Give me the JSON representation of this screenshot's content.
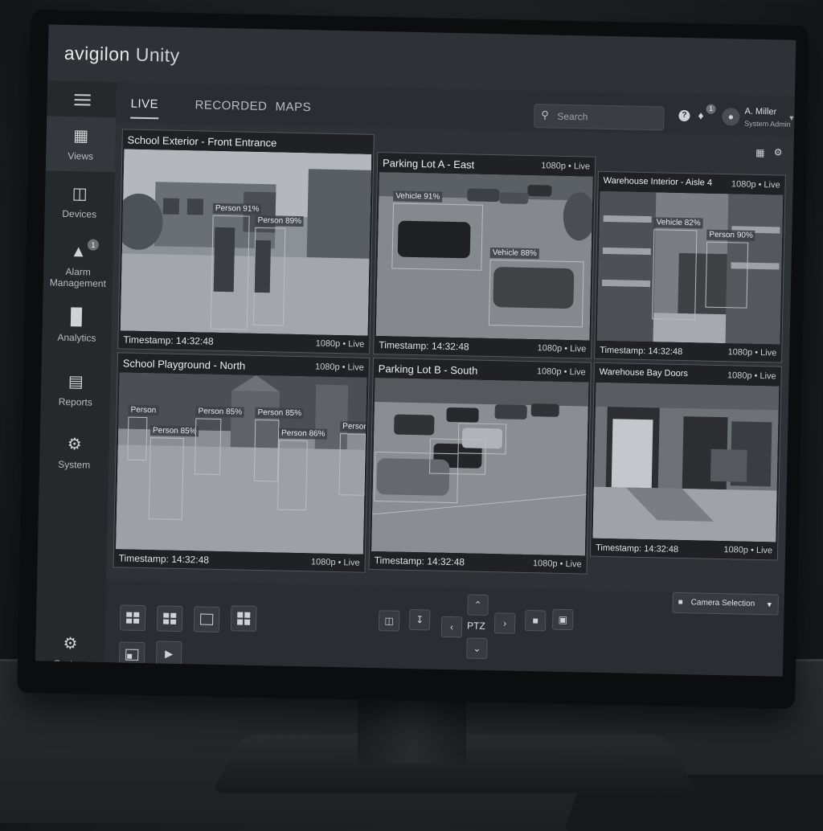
{
  "app": {
    "brand": "avigilon",
    "product": "Unity"
  },
  "sidebar": {
    "items": [
      {
        "label": "Views",
        "icon": "views-icon"
      },
      {
        "label": "Devices",
        "icon": "devices-icon"
      },
      {
        "label": "Alarm Management",
        "icon": "alarm-icon",
        "badge": "1"
      },
      {
        "label": "Analytics",
        "icon": "analytics-icon"
      },
      {
        "label": "Reports",
        "icon": "reports-icon"
      },
      {
        "label": "System",
        "icon": "gear-icon"
      }
    ],
    "bottom_item": {
      "label": "System",
      "icon": "gear-icon"
    }
  },
  "tabs": [
    {
      "label": "LIVE",
      "active": true
    },
    {
      "label": "RECORDED",
      "active": false
    },
    {
      "label": "MAPS",
      "active": false
    }
  ],
  "search": {
    "placeholder": "Search"
  },
  "notifications": {
    "count": "1"
  },
  "user": {
    "name": "A. Miller",
    "role": "System Admin"
  },
  "cameras": [
    {
      "title": "School Exterior - Front Entrance",
      "resolution_top": "1080p • Live",
      "timestamp": "Timestamp: 14:32:48",
      "resolution_bottom": "1080p • Live",
      "detections": [
        "Person 91%",
        "Person 89%"
      ]
    },
    {
      "title": "Parking Lot A - East",
      "resolution_top": "1080p • Live",
      "timestamp": "Timestamp: 14:32:48",
      "resolution_bottom": "1080p • Live",
      "detections": [
        "Vehicle 91%",
        "Vehicle 88%"
      ]
    },
    {
      "title": "Warehouse Interior - Aisle 4",
      "resolution_top": "1080p • Live",
      "timestamp": "Timestamp: 14:32:48",
      "resolution_bottom": "1080p • Live",
      "detections": [
        "Vehicle 82%",
        "Person 90%"
      ]
    },
    {
      "title": "School Playground - North",
      "resolution_top": "1080p • Live",
      "timestamp": "Timestamp: 14:32:48",
      "resolution_bottom": "1080p • Live",
      "detections": [
        "Person",
        "Person 85%",
        "Person 85%",
        "Person 85%",
        "Person 86%",
        "Person"
      ]
    },
    {
      "title": "Parking Lot B - South",
      "resolution_top": "1080p • Live",
      "timestamp": "Timestamp: 14:32:48",
      "resolution_bottom": "1080p • Live",
      "detections": []
    },
    {
      "title": "Warehouse Bay Doors",
      "resolution_top": "1080p • Live",
      "timestamp": "Timestamp: 14:32:48",
      "resolution_bottom": "1080p • Live",
      "detections": []
    }
  ],
  "controls": {
    "ptz_label": "PTZ",
    "camera_selection": "Camera Selection"
  }
}
